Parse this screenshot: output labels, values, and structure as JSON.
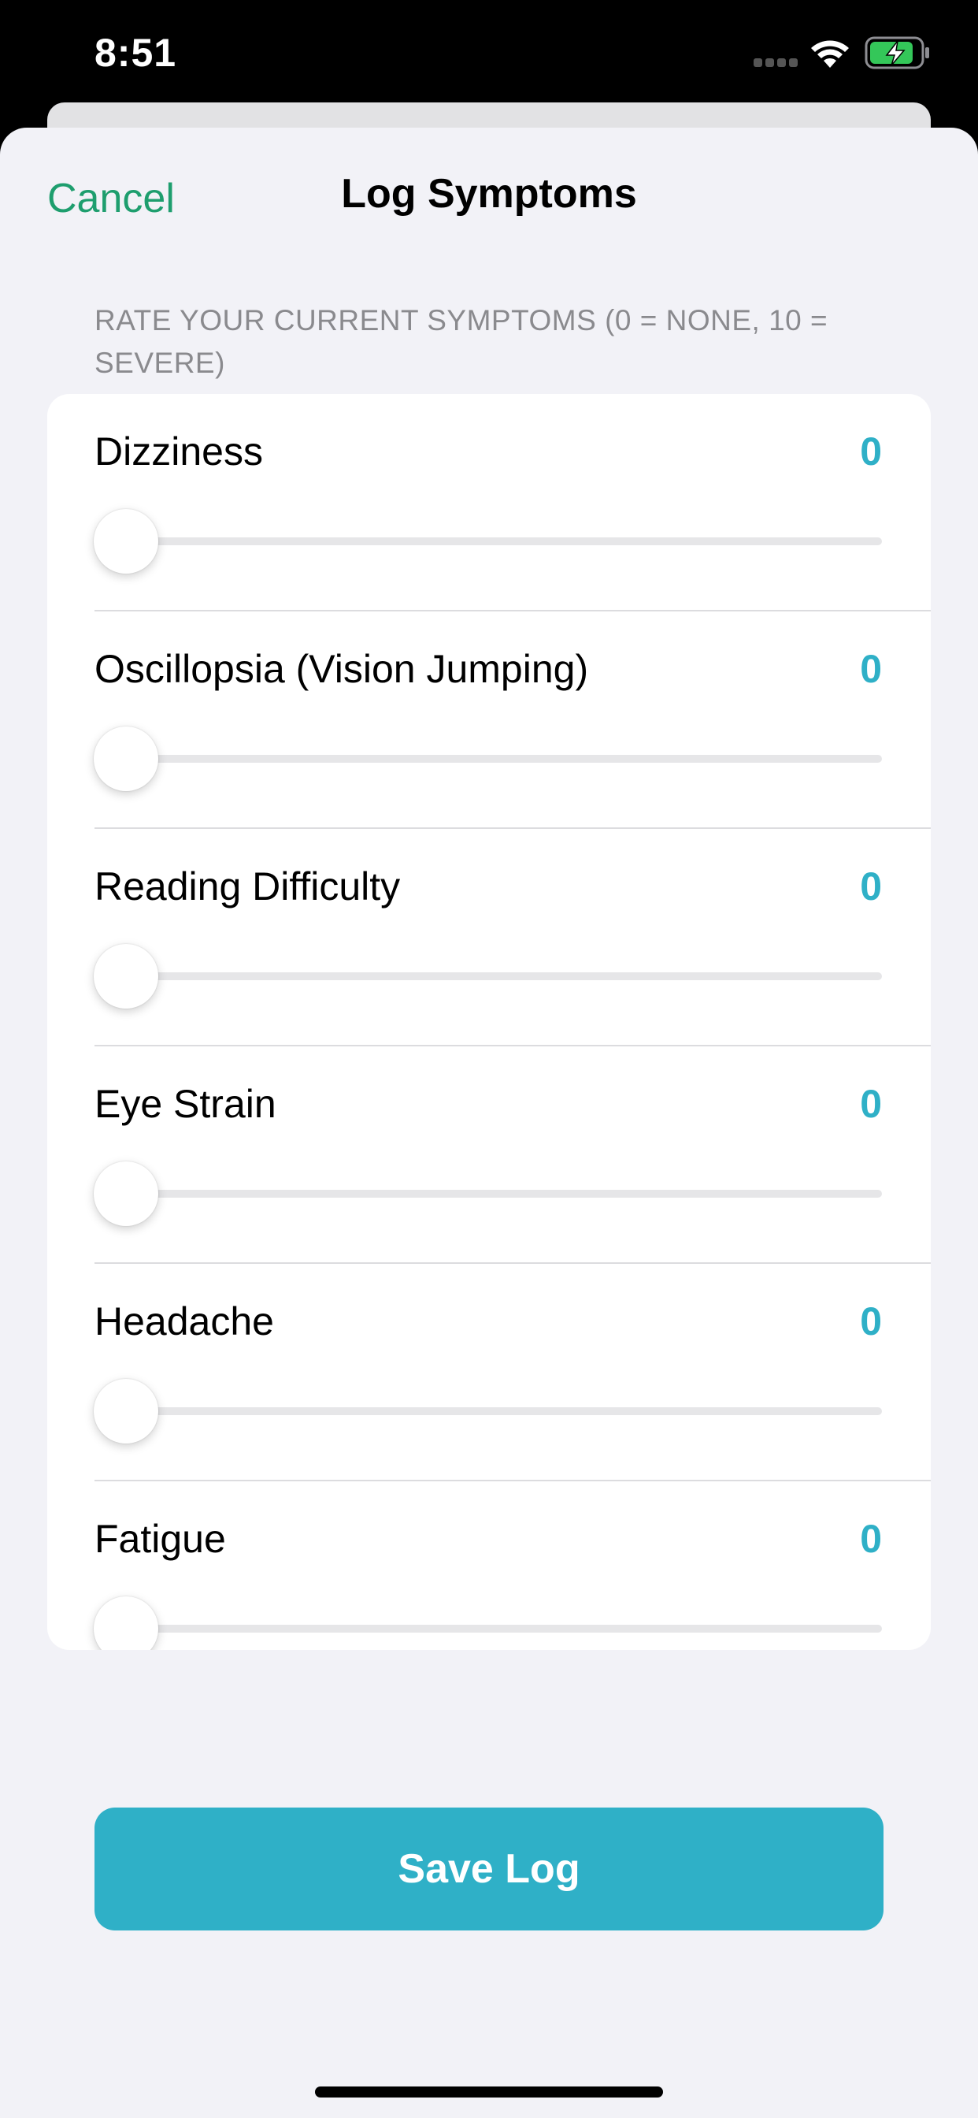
{
  "status_bar": {
    "time": "8:51",
    "icons": [
      "cellular-signal-icon",
      "wifi-icon",
      "battery-charging-icon"
    ]
  },
  "nav": {
    "cancel_label": "Cancel",
    "title": "Log Symptoms"
  },
  "section_header": "RATE YOUR CURRENT SYMPTOMS (0 = NONE, 10 = SEVERE)",
  "symptoms": [
    {
      "label": "Dizziness",
      "value": "0"
    },
    {
      "label": "Oscillopsia (Vision Jumping)",
      "value": "0"
    },
    {
      "label": "Reading Difficulty",
      "value": "0"
    },
    {
      "label": "Eye Strain",
      "value": "0"
    },
    {
      "label": "Headache",
      "value": "0"
    },
    {
      "label": "Fatigue",
      "value": "0"
    }
  ],
  "slider": {
    "min": 0,
    "max": 10
  },
  "save_label": "Save Log",
  "colors": {
    "accent": "#2fb0c7",
    "cancel": "#1e9e6e",
    "background": "#f2f2f7"
  }
}
